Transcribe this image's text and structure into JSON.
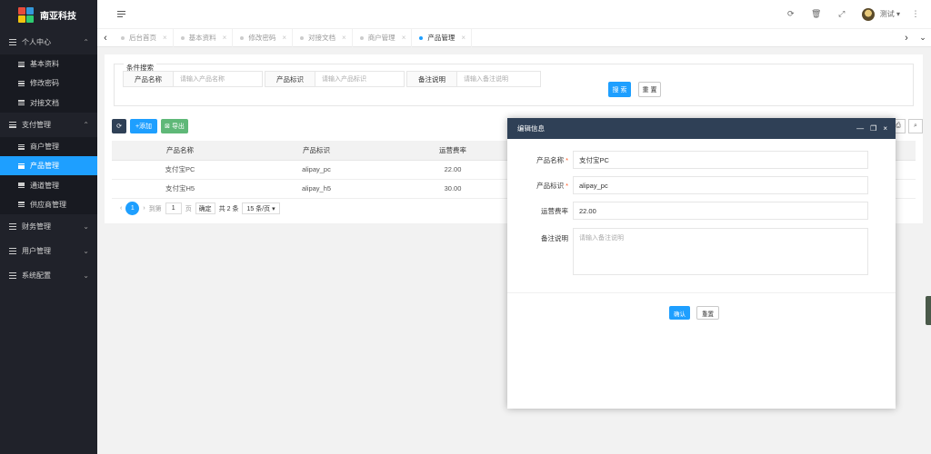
{
  "app": {
    "name": "南亚科技"
  },
  "sidebar": {
    "groups": [
      {
        "label": "个人中心",
        "chev": "⌃",
        "items": [
          "基本资料",
          "修改密码",
          "对接文档"
        ]
      },
      {
        "label": "支付管理",
        "chev": "⌃",
        "items": [
          "商户管理",
          "产品管理",
          "通道管理",
          "供应商管理"
        ]
      },
      {
        "label": "财务管理",
        "chev": "⌄"
      },
      {
        "label": "用户管理",
        "chev": "⌄"
      },
      {
        "label": "系统配置",
        "chev": "⌄"
      }
    ]
  },
  "header": {
    "user": "测试 ▾",
    "icons": [
      "refresh-icon",
      "trash-icon",
      "fullscreen-icon",
      "more-icon"
    ]
  },
  "tabs": [
    {
      "label": "后台首页"
    },
    {
      "label": "基本资料"
    },
    {
      "label": "修改密码"
    },
    {
      "label": "对接文档"
    },
    {
      "label": "商户管理"
    },
    {
      "label": "产品管理",
      "active": true
    }
  ],
  "search": {
    "legend": "条件搜索",
    "fields": [
      {
        "label": "产品名称",
        "placeholder": "请输入产品名称"
      },
      {
        "label": "产品标识",
        "placeholder": "请输入产品标识"
      },
      {
        "label": "备注说明",
        "placeholder": "请输入备注说明"
      }
    ],
    "search_btn": "搜 索",
    "reset_btn": "重 置"
  },
  "toolbar": {
    "add": "+添加",
    "export": "导出"
  },
  "table": {
    "headers": [
      "产品名称",
      "产品标识",
      "运营费率"
    ],
    "rows": [
      [
        "支付宝PC",
        "alipay_pc",
        "22.00"
      ],
      [
        "支付宝H5",
        "alipay_h5",
        "30.00"
      ]
    ]
  },
  "pager": {
    "current": "1",
    "goto_label": "到第",
    "goto_value": "1",
    "page_unit": "页",
    "confirm": "确定",
    "total": "共 2 条",
    "size": "15 条/页 ▾"
  },
  "modal": {
    "title": "编辑信息",
    "fields": [
      {
        "label": "产品名称",
        "required": true,
        "value": "支付宝PC"
      },
      {
        "label": "产品标识",
        "required": true,
        "value": "alipay_pc"
      },
      {
        "label": "运营费率",
        "required": false,
        "value": "22.00"
      }
    ],
    "remark_label": "备注说明",
    "remark_placeholder": "请输入备注说明",
    "confirm": "确认",
    "reset": "重置"
  }
}
